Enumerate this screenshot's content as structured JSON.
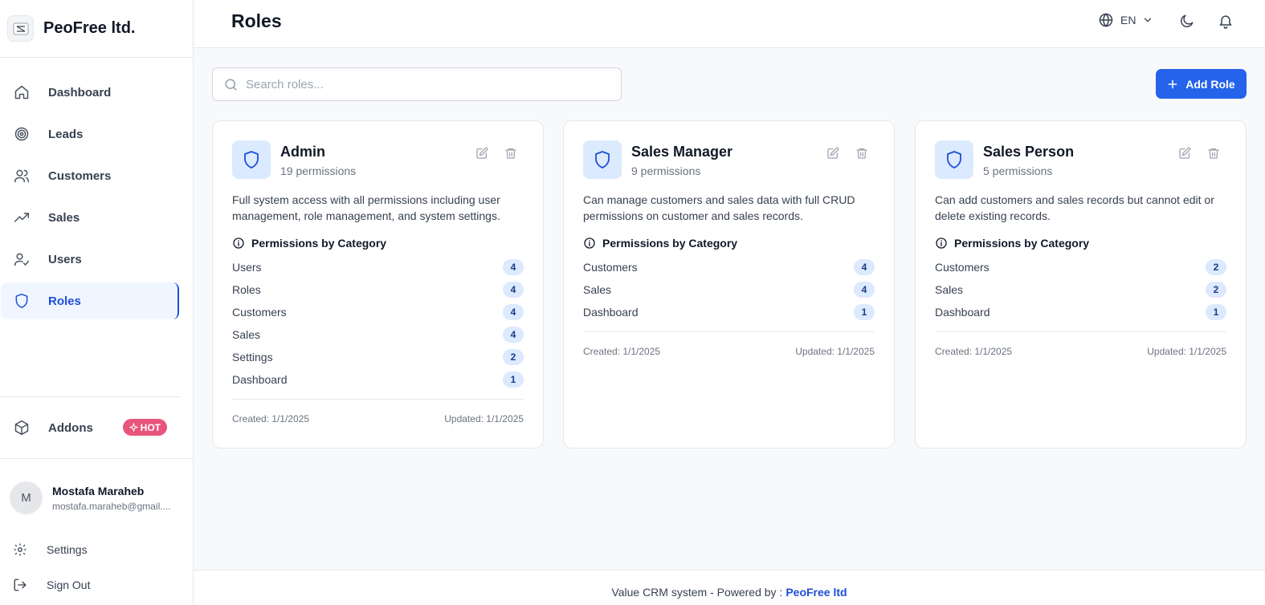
{
  "sidebar": {
    "brand": "PeoFree ltd.",
    "nav": [
      {
        "label": "Dashboard",
        "icon": "home-icon"
      },
      {
        "label": "Leads",
        "icon": "target-icon"
      },
      {
        "label": "Customers",
        "icon": "users-icon"
      },
      {
        "label": "Sales",
        "icon": "trending-up-icon"
      },
      {
        "label": "Users",
        "icon": "user-check-icon"
      },
      {
        "label": "Roles",
        "icon": "shield-icon"
      }
    ],
    "active": "Roles",
    "addons_label": "Addons",
    "hot_badge": "HOT",
    "user": {
      "initial": "M",
      "name": "Mostafa Maraheb",
      "email": "mostafa.maraheb@gmail...."
    },
    "settings_label": "Settings",
    "signout_label": "Sign Out"
  },
  "header": {
    "title": "Roles",
    "language": "EN"
  },
  "toolbar": {
    "search_placeholder": "Search roles...",
    "add_label": "Add Role"
  },
  "section_label": "Permissions by Category",
  "roles": [
    {
      "name": "Admin",
      "permissions": "19 permissions",
      "description": "Full system access with all permissions including user management, role management, and system settings.",
      "categories": [
        {
          "name": "Users",
          "count": "4"
        },
        {
          "name": "Roles",
          "count": "4"
        },
        {
          "name": "Customers",
          "count": "4"
        },
        {
          "name": "Sales",
          "count": "4"
        },
        {
          "name": "Settings",
          "count": "2"
        },
        {
          "name": "Dashboard",
          "count": "1"
        }
      ],
      "created": "Created: 1/1/2025",
      "updated": "Updated: 1/1/2025"
    },
    {
      "name": "Sales Manager",
      "permissions": "9 permissions",
      "description": "Can manage customers and sales data with full CRUD permissions on customer and sales records.",
      "categories": [
        {
          "name": "Customers",
          "count": "4"
        },
        {
          "name": "Sales",
          "count": "4"
        },
        {
          "name": "Dashboard",
          "count": "1"
        }
      ],
      "created": "Created: 1/1/2025",
      "updated": "Updated: 1/1/2025"
    },
    {
      "name": "Sales Person",
      "permissions": "5 permissions",
      "description": "Can add customers and sales records but cannot edit or delete existing records.",
      "categories": [
        {
          "name": "Customers",
          "count": "2"
        },
        {
          "name": "Sales",
          "count": "2"
        },
        {
          "name": "Dashboard",
          "count": "1"
        }
      ],
      "created": "Created: 1/1/2025",
      "updated": "Updated: 1/1/2025"
    }
  ],
  "footer": {
    "text": "Value CRM system - Powered by :",
    "link": "PeoFree ltd"
  },
  "colors": {
    "accent": "#2563eb",
    "accent_dark": "#1d4ed8",
    "badge_bg": "#dbeafe",
    "hot": "#e8557a"
  }
}
